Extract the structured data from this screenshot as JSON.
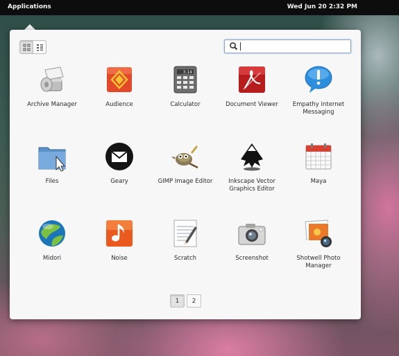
{
  "panel": {
    "applications_label": "Applications",
    "clock": "Wed Jun 20  2:32 PM"
  },
  "view_toggle": {
    "grid_icon": "grid-view-icon",
    "list_icon": "category-view-icon",
    "active": "grid"
  },
  "search": {
    "value": "",
    "icon": "search-icon"
  },
  "apps": [
    {
      "label": "Archive Manager",
      "icon": "archive-manager-icon"
    },
    {
      "label": "Audience",
      "icon": "audience-icon"
    },
    {
      "label": "Calculator",
      "icon": "calculator-icon"
    },
    {
      "label": "Document Viewer",
      "icon": "document-viewer-icon"
    },
    {
      "label": "Empathy Internet Messaging",
      "icon": "empathy-icon"
    },
    {
      "label": "Files",
      "icon": "files-icon"
    },
    {
      "label": "Geary",
      "icon": "geary-icon"
    },
    {
      "label": "GIMP Image Editor",
      "icon": "gimp-icon"
    },
    {
      "label": "Inkscape Vector Graphics Editor",
      "icon": "inkscape-icon"
    },
    {
      "label": "Maya",
      "icon": "maya-icon"
    },
    {
      "label": "Midori",
      "icon": "midori-icon"
    },
    {
      "label": "Noise",
      "icon": "noise-icon"
    },
    {
      "label": "Scratch",
      "icon": "scratch-icon"
    },
    {
      "label": "Screenshot",
      "icon": "screenshot-icon"
    },
    {
      "label": "Shotwell Photo Manager",
      "icon": "shotwell-icon"
    }
  ],
  "pager": {
    "pages": [
      "1",
      "2"
    ],
    "current": "1"
  },
  "colors": {
    "panel": "#0d0d0d",
    "popover": "#f7f7f7",
    "search_focus": "#8aa4c6"
  }
}
